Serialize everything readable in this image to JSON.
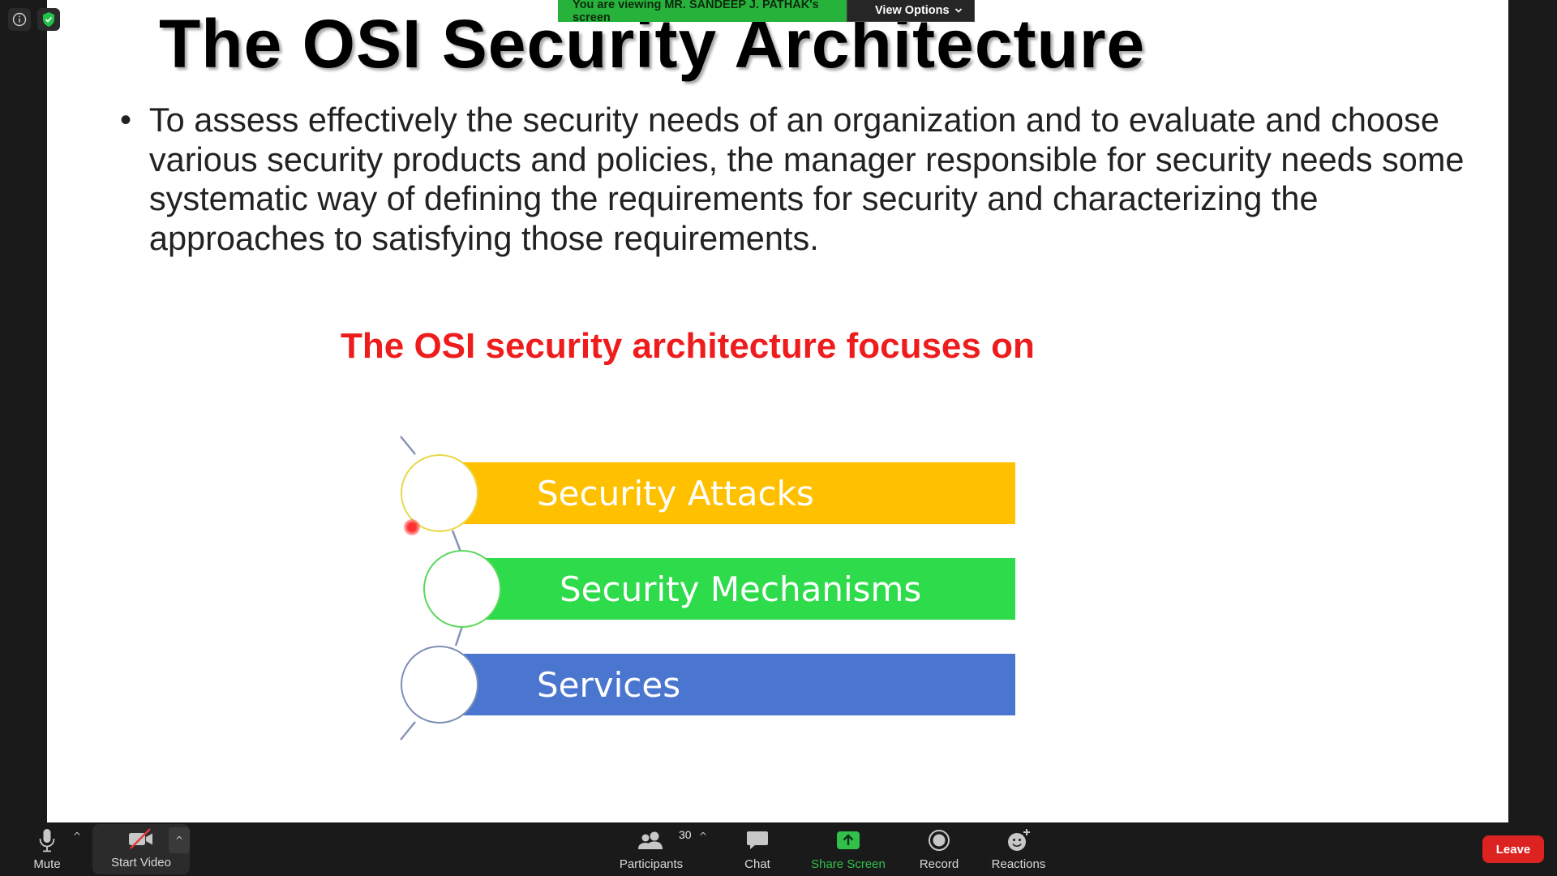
{
  "meeting": {
    "share_banner_text": "You are viewing MR. SANDEEP J. PATHAK's screen",
    "view_options_label": "View Options"
  },
  "slide": {
    "title": "The OSI Security Architecture",
    "bullet_text": "To assess effectively the security needs of an organization and to evaluate and choose various security products and policies, the manager responsible for security needs some systematic way of defining the requirements for security and characterizing the approaches to satisfying those requirements.",
    "focus_heading": "The OSI security architecture focuses on",
    "diagram_items": [
      {
        "label": "Security Attacks",
        "color": "#ffc000"
      },
      {
        "label": "Security Mechanisms",
        "color": "#2edb4a"
      },
      {
        "label": "Services",
        "color": "#4a76d0"
      }
    ]
  },
  "toolbar": {
    "mute_label": "Mute",
    "video_label": "Start Video",
    "participants_label": "Participants",
    "participants_count": "30",
    "chat_label": "Chat",
    "share_label": "Share Screen",
    "record_label": "Record",
    "reactions_label": "Reactions",
    "leave_label": "Leave"
  },
  "colors": {
    "share_green": "#31c14b",
    "banner_green": "#27b33b",
    "leave_red": "#dd2222",
    "heading_red": "#ee1c1c",
    "toolbar_bg": "#1a1a1a"
  }
}
